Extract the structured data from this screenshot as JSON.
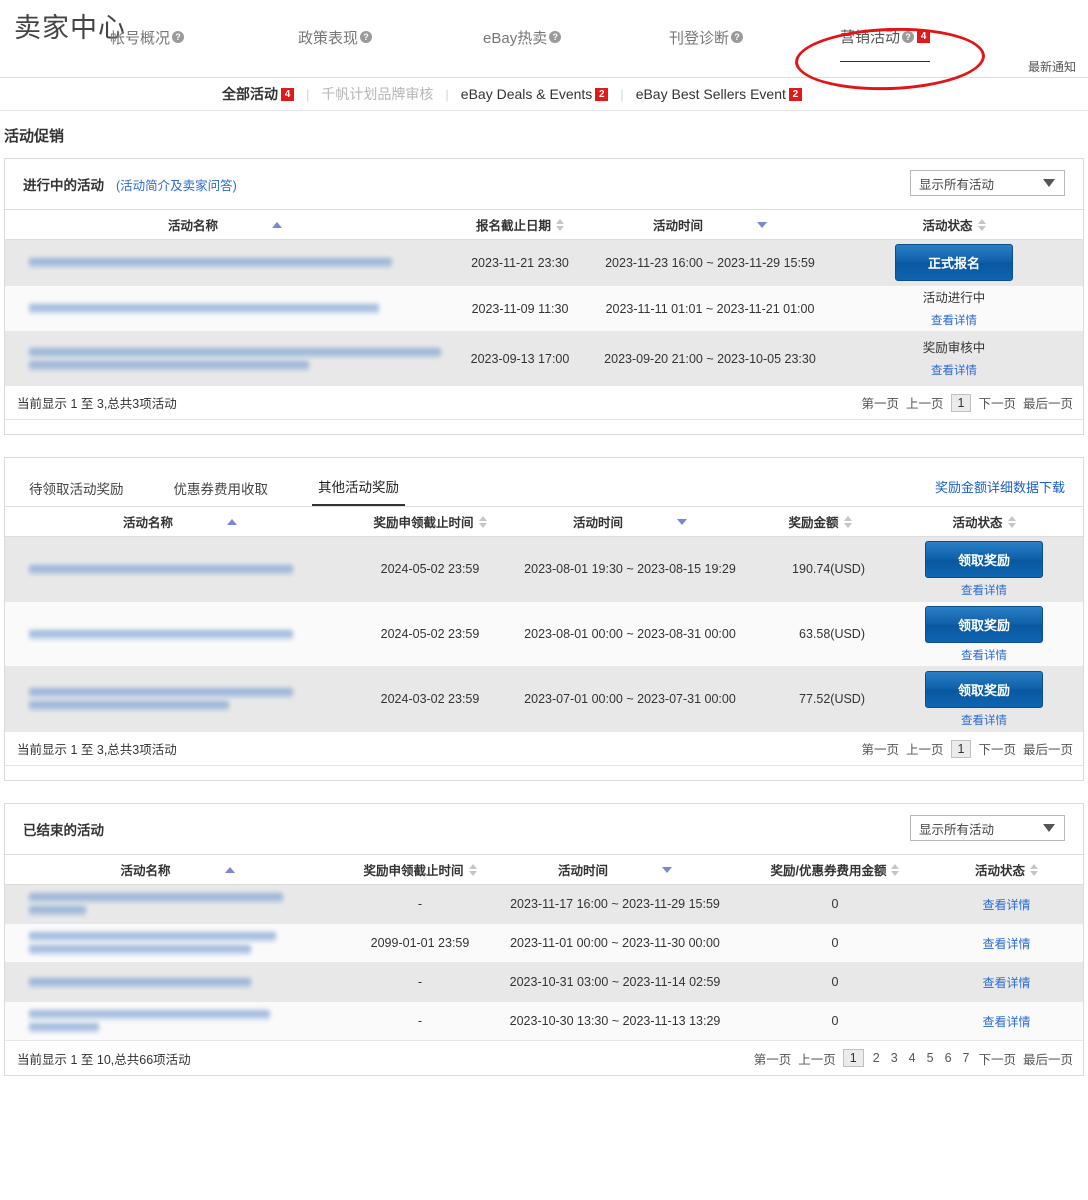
{
  "header": {
    "brand": "卖家中心",
    "latest_notice": "最新通知",
    "nav": [
      {
        "label": "帐号概况",
        "help": true,
        "badge": null,
        "active": false
      },
      {
        "label": "政策表现",
        "help": true,
        "badge": null,
        "active": false
      },
      {
        "label": "eBay热卖",
        "help": true,
        "badge": null,
        "active": false
      },
      {
        "label": "刊登诊断",
        "help": true,
        "badge": null,
        "active": false
      },
      {
        "label": "营销活动",
        "help": true,
        "badge": "4",
        "active": true
      }
    ]
  },
  "subnav": [
    {
      "label": "全部活动",
      "badge": "4",
      "style": "bold"
    },
    {
      "label": "千帆计划品牌审核",
      "badge": null,
      "style": "dim"
    },
    {
      "label": "eBay Deals & Events",
      "badge": "2",
      "style": "normal"
    },
    {
      "label": "eBay Best Sellers Event",
      "badge": "2",
      "style": "normal"
    }
  ],
  "page_title": "活动促销",
  "colors": {
    "accent_blue": "#0d5fa8",
    "link_blue": "#2b6bd4",
    "badge_red": "#e01a1a",
    "sort_active": "#7b86d8",
    "annotation_red": "#e11515"
  },
  "section_ongoing": {
    "title": "进行中的活动",
    "link": "(活动简介及卖家问答)",
    "filter_value": "显示所有活动",
    "columns": [
      "活动名称",
      "报名截止日期",
      "活动时间",
      "活动状态"
    ],
    "rows": [
      {
        "name_lines": [
          88
        ],
        "deadline": "2023-11-21 23:30",
        "period": "2023-11-23 16:00 ~ 2023-11-29 15:59",
        "status_kind": "button",
        "status_text": "正式报名",
        "detail": null
      },
      {
        "name_lines": [
          85
        ],
        "deadline": "2023-11-09 11:30",
        "period": "2023-11-11 01:01 ~ 2023-11-21 01:00",
        "status_kind": "text",
        "status_text": "活动进行中",
        "detail": "查看详情"
      },
      {
        "name_lines": [
          100,
          68
        ],
        "deadline": "2023-09-13 17:00",
        "period": "2023-09-20 21:00 ~ 2023-10-05 23:30",
        "status_kind": "text",
        "status_text": "奖励审核中",
        "detail": "查看详情"
      }
    ],
    "footer_text": "当前显示 1 至 3,总共3项活动",
    "pager": {
      "first": "第一页",
      "prev": "上一页",
      "pages": [
        "1"
      ],
      "current": "1",
      "next": "下一页",
      "last": "最后一页"
    }
  },
  "section_rewards": {
    "tabs": [
      {
        "label": "待领取活动奖励",
        "active": false
      },
      {
        "label": "优惠券费用收取",
        "active": false
      },
      {
        "label": "其他活动奖励",
        "active": true
      }
    ],
    "download_link": "奖励金额详细数据下载",
    "columns": [
      "活动名称",
      "奖励申领截止时间",
      "活动时间",
      "奖励金额",
      "活动状态"
    ],
    "rows": [
      {
        "name_lines": [
          82
        ],
        "deadline": "2024-05-02 23:59",
        "period": "2023-08-01 19:30 ~ 2023-08-15 19:29",
        "amount": "190.74(USD)",
        "status_text": "领取奖励",
        "detail": "查看详情"
      },
      {
        "name_lines": [
          82
        ],
        "deadline": "2024-05-02 23:59",
        "period": "2023-08-01 00:00 ~ 2023-08-31 00:00",
        "amount": "63.58(USD)",
        "status_text": "领取奖励",
        "detail": "查看详情"
      },
      {
        "name_lines": [
          82,
          62
        ],
        "deadline": "2024-03-02 23:59",
        "period": "2023-07-01 00:00 ~ 2023-07-31 00:00",
        "amount": "77.52(USD)",
        "status_text": "领取奖励",
        "detail": "查看详情"
      }
    ],
    "footer_text": "当前显示 1 至 3,总共3项活动",
    "pager": {
      "first": "第一页",
      "prev": "上一页",
      "pages": [
        "1"
      ],
      "current": "1",
      "next": "下一页",
      "last": "最后一页"
    }
  },
  "section_ended": {
    "title": "已结束的活动",
    "filter_value": "显示所有活动",
    "columns": [
      "活动名称",
      "奖励申领截止时间",
      "活动时间",
      "奖励/优惠券费用金额",
      "活动状态"
    ],
    "rows": [
      {
        "name_lines": [
          80,
          18
        ],
        "deadline": "-",
        "period": "2023-11-17 16:00 ~ 2023-11-29 15:59",
        "amount": "0",
        "detail": "查看详情"
      },
      {
        "name_lines": [
          78,
          70
        ],
        "deadline": "2099-01-01 23:59",
        "period": "2023-11-01 00:00 ~ 2023-11-30 00:00",
        "amount": "0",
        "detail": "查看详情"
      },
      {
        "name_lines": [
          70
        ],
        "deadline": "-",
        "period": "2023-10-31 03:00 ~ 2023-11-14 02:59",
        "amount": "0",
        "detail": "查看详情"
      },
      {
        "name_lines": [
          76,
          22
        ],
        "deadline": "-",
        "period": "2023-10-30 13:30 ~ 2023-11-13 13:29",
        "amount": "0",
        "detail": "查看详情"
      }
    ],
    "footer_text": "当前显示 1 至 10,总共66项活动",
    "pager": {
      "first": "第一页",
      "prev": "上一页",
      "pages": [
        "1",
        "2",
        "3",
        "4",
        "5",
        "6",
        "7"
      ],
      "current": "1",
      "next": "下一页",
      "last": "最后一页"
    }
  }
}
